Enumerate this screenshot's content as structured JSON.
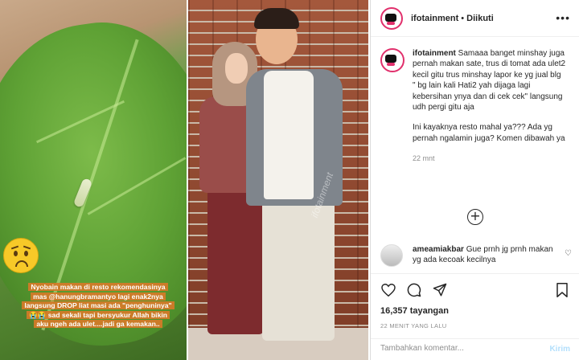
{
  "story": {
    "caption_lines": [
      "Nyobain makan di resto rekomendasinya",
      "mas @hanungbramantyo lagi enak2nya",
      "langsung DROP liat masi ada \"penghuninya\"",
      "😭😭 sad sekali tapi bersyukur Allah bikin",
      "aku ngeh ada ulet....jadi ga kemakan.."
    ]
  },
  "photo": {
    "watermark": "ifotainment"
  },
  "post": {
    "username": "ifotainment",
    "separator": "•",
    "follow_status": "Diikuti",
    "more_icon": "more-horizontal-icon",
    "caption_username": "ifotainment",
    "caption_paragraphs": [
      "Samaaa banget minshay juga pernah makan sate, trus di tomat ada ulet2 kecil gitu trus minshay lapor ke yg jual blg",
      "\" bg lain kali Hati2 yah dijaga lagi kebersihan ynya dan di cek cek\" langsung udh pergi gitu aja",
      "Ini kayaknya resto mahal ya??? Ada yg pernah ngalamin juga? Komen dibawah ya"
    ],
    "caption_time": "22 mnt",
    "load_more_icon": "plus-circle-icon",
    "comments": [
      {
        "username": "ameamiakbar",
        "text": "Gue prnh jg prnh makan yg ada kecoak kecilnya"
      }
    ],
    "views": "16,357 tayangan",
    "posted": "22 MENIT YANG LALU",
    "add_comment_placeholder": "Tambahkan komentar...",
    "send_label": "Kirim"
  },
  "colors": {
    "accent": "#e1306c",
    "send_disabled": "#b2dffc",
    "caption_bg": "#d67a28"
  }
}
